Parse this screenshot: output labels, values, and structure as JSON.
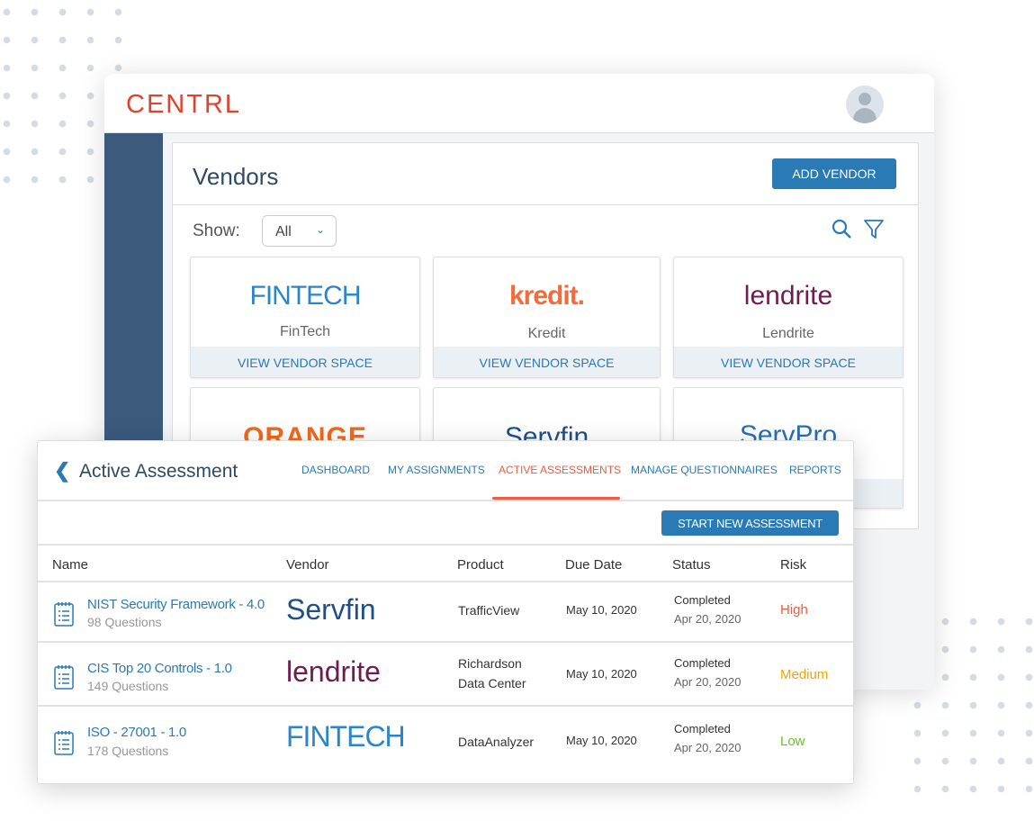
{
  "app": {
    "logo": "CENTRL"
  },
  "vendors_page": {
    "title": "Vendors",
    "add_vendor": "ADD VENDOR",
    "show_label": "Show:",
    "show_value": "All",
    "cards": [
      {
        "logo": "FINTECH",
        "name": "FinTech",
        "action": "VIEW VENDOR SPACE"
      },
      {
        "logo": "kredit.",
        "name": "Kredit",
        "action": "VIEW VENDOR SPACE"
      },
      {
        "logo": "lendrite",
        "name": "Lendrite",
        "action": "VIEW VENDOR SPACE"
      },
      {
        "logo": "ORANGE"
      },
      {
        "logo": "Servfin"
      },
      {
        "logo": "ServPro"
      }
    ]
  },
  "assessment": {
    "title": "Active Assessment",
    "tabs": [
      "DASHBOARD",
      "MY ASSIGNMENTS",
      "ACTIVE ASSESSMENTS",
      "MANAGE QUESTIONNAIRES",
      "REPORTS"
    ],
    "active_tab": "ACTIVE ASSESSMENTS",
    "start_button": "START NEW ASSESSMENT",
    "columns": [
      "Name",
      "Vendor",
      "Product",
      "Due Date",
      "Status",
      "Risk"
    ],
    "rows": [
      {
        "name": "NIST Security Framework - 4.0",
        "questions": "98 Questions",
        "vendor": "Servfin",
        "product": "TrafficView",
        "due": "May 10, 2020",
        "status": "Completed",
        "status_date": "Apr 20, 2020",
        "risk": "High",
        "risk_color": "#f05a40"
      },
      {
        "name": "CIS Top 20 Controls - 1.0",
        "questions": "149 Questions",
        "vendor": "lendrite",
        "product": "Richardson Data Center",
        "due": "May 10, 2020",
        "status": "Completed",
        "status_date": "Apr 20, 2020",
        "risk": "Medium",
        "risk_color": "#f5a300"
      },
      {
        "name": "ISO - 27001 - 1.0",
        "questions": "178 Questions",
        "vendor": "FINTECH",
        "product": "DataAnalyzer",
        "due": "May 10, 2020",
        "status": "Completed",
        "status_date": "Apr 20, 2020",
        "risk": "Low",
        "risk_color": "#6cc12a"
      }
    ]
  },
  "colors": {
    "accent": "#2a7ab5",
    "brand": "#e0432d",
    "sidebar": "#3b5a7c",
    "active_tab": "#f05a40"
  }
}
